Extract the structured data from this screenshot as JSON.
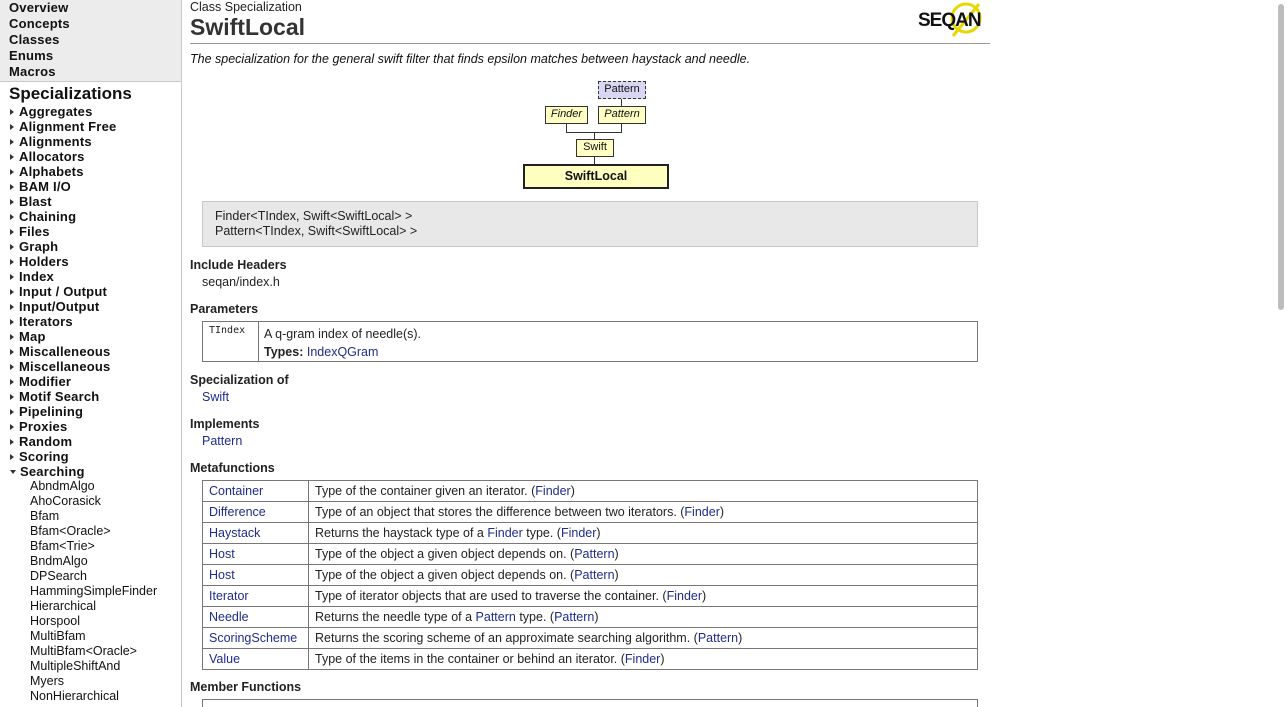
{
  "nav": {
    "top_links": [
      "Overview",
      "Concepts",
      "Classes",
      "Enums",
      "Macros"
    ],
    "specializations_heading": "Specializations",
    "categories": [
      "Aggregates",
      "Alignment Free",
      "Alignments",
      "Allocators",
      "Alphabets",
      "BAM I/O",
      "Blast",
      "Chaining",
      "Files",
      "Graph",
      "Holders",
      "Index",
      "Input / Output",
      "Input/Output",
      "Iterators",
      "Map",
      "Miscalleneous",
      "Miscellaneous",
      "Modifier",
      "Motif Search",
      "Pipelining",
      "Proxies",
      "Random",
      "Scoring"
    ],
    "expanded_category": "Searching",
    "searching_items": [
      "AbndmAlgo",
      "AhoCorasick",
      "Bfam",
      "Bfam<Oracle>",
      "Bfam<Trie>",
      "BndmAlgo",
      "DPSearch",
      "HammingSimpleFinder",
      "Hierarchical",
      "Horspool",
      "MultiBfam",
      "MultiBfam<Oracle>",
      "MultipleShiftAnd",
      "Myers",
      "NonHierarchical"
    ]
  },
  "page": {
    "kind_label": "Class Specialization",
    "title": "SwiftLocal",
    "logo_text": "SEQAN",
    "summary": "The specialization for the general swift filter that finds epsilon matches between haystack and needle."
  },
  "diagram": {
    "top_dashed": "Pattern",
    "finder": "Finder",
    "pattern": "Pattern",
    "swift": "Swift",
    "current": "SwiftLocal"
  },
  "signatures": [
    "Finder<TIndex, Swift<SwiftLocal> >",
    "Pattern<TIndex, Swift<SwiftLocal> >"
  ],
  "include_headers": {
    "heading": "Include Headers",
    "value": "seqan/index.h"
  },
  "parameters": {
    "heading": "Parameters",
    "name": "TIndex",
    "description": "A q-gram index of needle(s).",
    "types_label": "Types:",
    "types_value": "IndexQGram"
  },
  "specialization_of": {
    "heading": "Specialization of",
    "value": "Swift"
  },
  "implements": {
    "heading": "Implements",
    "value": "Pattern"
  },
  "metafunctions": {
    "heading": "Metafunctions",
    "rows": [
      {
        "name": "Container",
        "pre": "Type of the container given an iterator. (",
        "mid_link": "",
        "mid": "",
        "source": "Finder",
        "post": ")"
      },
      {
        "name": "Difference",
        "pre": "Type of an object that stores the difference between two iterators. (",
        "mid_link": "",
        "mid": "",
        "source": "Finder",
        "post": ")"
      },
      {
        "name": "Haystack",
        "pre": "Returns the haystack type of a ",
        "mid_link": "Finder",
        "mid": " type. (",
        "source": "Finder",
        "post": ")"
      },
      {
        "name": "Host",
        "pre": "Type of the object a given object depends on. (",
        "mid_link": "",
        "mid": "",
        "source": "Pattern",
        "post": ")"
      },
      {
        "name": "Host",
        "pre": "Type of the object a given object depends on. (",
        "mid_link": "",
        "mid": "",
        "source": "Pattern",
        "post": ")"
      },
      {
        "name": "Iterator",
        "pre": "Type of iterator objects that are used to traverse the container. (",
        "mid_link": "",
        "mid": "",
        "source": "Finder",
        "post": ")"
      },
      {
        "name": "Needle",
        "pre": "Returns the needle type of a ",
        "mid_link": "Pattern",
        "mid": " type. (",
        "source": "Pattern",
        "post": ")"
      },
      {
        "name": "ScoringScheme",
        "pre": "Returns the scoring scheme of an approximate searching algorithm. (",
        "mid_link": "",
        "mid": "",
        "source": "Pattern",
        "post": ")"
      },
      {
        "name": "Value",
        "pre": "Type of the items in the container or behind an iterator. (",
        "mid_link": "",
        "mid": "",
        "source": "Finder",
        "post": ")"
      }
    ]
  },
  "member_functions": {
    "heading": "Member Functions"
  },
  "colors": {
    "link": "#1f2c8a",
    "node_fill": "#ffffc4",
    "node_dashed_fill": "#d9d6f3",
    "logo_yellow": "#e8d800"
  }
}
